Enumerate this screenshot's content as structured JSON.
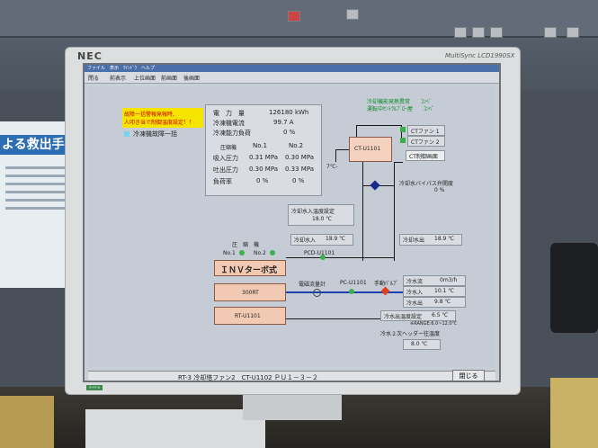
{
  "monitor": {
    "brand": "NEC",
    "model": "MultiSync LCD1990SX",
    "power_label": "ｵｰﾄｸｰﾙ"
  },
  "poster": {
    "heading": "よる救出手"
  },
  "menubar": {
    "title": "ファイル　表示　ｳｲﾝﾄﾞｳ　ヘルプ",
    "items": [
      "閉る",
      "前表示",
      "上位画面",
      "前画面",
      "後画面"
    ]
  },
  "alarm": {
    "line1": "故障一括警報発報時,",
    "line2": "人叩き当で制御温度設定！！",
    "fault_label": "冷凍機故障一括"
  },
  "header_note": {
    "line1": "冷却機能発熱異常　　ｺﾝﾍﾟ",
    "line2": "運転中ｾﾝﾄﾗﾙﾌﾞﾛｰ屋　　ｺﾝﾍﾟ"
  },
  "stats": {
    "power_label": "電　力　量",
    "power_value": "126180 kWh",
    "current_label": "冷凍機電流",
    "current_value": "99.7 A",
    "capacity_label": "冷凍能力負荷",
    "capacity_value": "0 %",
    "col_head": "圧縮機",
    "col1": "No.1",
    "col2": "No.2",
    "rows": [
      {
        "label": "吸入圧力",
        "v1": "0.31 MPa",
        "v2": "0.30 MPa"
      },
      {
        "label": "吐出圧力",
        "v1": "0.30 MPa",
        "v2": "0.33 MPa"
      },
      {
        "label": "負荷率",
        "v1": "0 %",
        "v2": "0 %"
      }
    ]
  },
  "ct": {
    "unit": "CT-U1101",
    "fan1": "CTファン 1",
    "fan2": "CTファン 2",
    "control_btn": "CT制御画面",
    "temp_hint": "7℃-"
  },
  "bypass": {
    "label": "冷却水バイパス弁開度",
    "value": "0 %"
  },
  "cooling_setpoint": {
    "label": "冷却水入温度設定",
    "value": "18.0 ℃"
  },
  "cooling_in": {
    "label": "冷却水入",
    "value": "18.9 ℃"
  },
  "cooling_out": {
    "label": "冷却水出",
    "value": "18.9 ℃"
  },
  "compressor": {
    "heading": "圧　縮　機",
    "no1": "No.1",
    "no2": "No.2",
    "pcd": "PCD-U1101",
    "title": "ＩＮＶターボ式",
    "model": "300RT",
    "rt_unit": "RT-U1101"
  },
  "chilled": {
    "meter_label": "電磁流量計",
    "pc_unit": "PC-U1101",
    "valve_label": "手動ﾊﾞﾙﾌﾞ",
    "flow_label": "冷水流",
    "flow_value": "0m3/h",
    "in_label": "冷水入",
    "in_value": "10.1 ℃",
    "out_label": "冷水出",
    "out_value": "9.8 ℃",
    "setpoint_label": "冷水出温度設定",
    "setpoint_value": "6.5 ℃",
    "range_note": "※RANGE:6.0~12.0℃",
    "header_label": "冷水２次ヘッダー往温度",
    "header_value": "8.0 ℃"
  },
  "statusbar": {
    "text": "RT-3 冷却塔ファン2　CT-U1102 ＰＵ１－３－２",
    "close": "閉じる"
  }
}
